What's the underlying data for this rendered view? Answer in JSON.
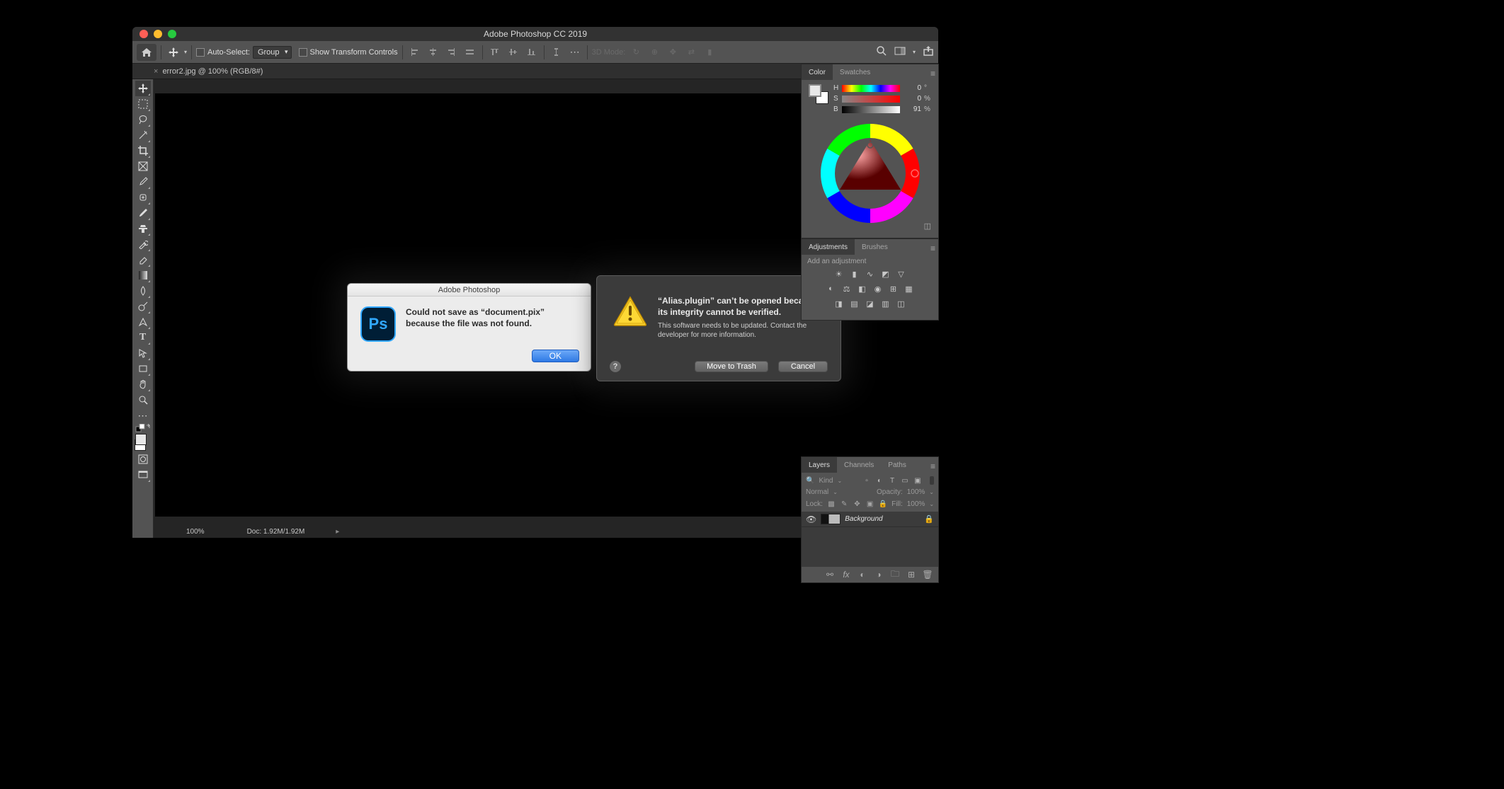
{
  "app": {
    "title": "Adobe Photoshop CC 2019"
  },
  "options_bar": {
    "auto_select_label": "Auto-Select:",
    "auto_select_value": "Group",
    "show_transform_label": "Show Transform Controls",
    "mode_3d_label": "3D Mode:"
  },
  "document_tab": {
    "label": "error2.jpg @ 100% (RGB/8#)"
  },
  "status_bar": {
    "zoom": "100%",
    "doc_size": "Doc: 1.92M/1.92M"
  },
  "color_panel": {
    "tab_color": "Color",
    "tab_swatches": "Swatches",
    "h": {
      "label": "H",
      "value": "0",
      "unit": "°"
    },
    "s": {
      "label": "S",
      "value": "0",
      "unit": "%"
    },
    "b": {
      "label": "B",
      "value": "91",
      "unit": "%"
    }
  },
  "adjustments_panel": {
    "tab_adjustments": "Adjustments",
    "tab_brushes": "Brushes",
    "hint": "Add an adjustment"
  },
  "layers_panel": {
    "tab_layers": "Layers",
    "tab_channels": "Channels",
    "tab_paths": "Paths",
    "kind_label": "Kind",
    "blend_mode": "Normal",
    "opacity_label": "Opacity:",
    "opacity_value": "100%",
    "lock_label": "Lock:",
    "fill_label": "Fill:",
    "fill_value": "100%",
    "layer_name": "Background"
  },
  "dialog_light": {
    "title": "Adobe Photoshop",
    "message": "Could not save as “document.pix” because the file was not found.",
    "ok_label": "OK"
  },
  "dialog_dark": {
    "message_bold": "“Alias.plugin” can’t be opened because its integrity cannot be verified.",
    "message_sub": "This software needs to be updated. Contact the developer for more information.",
    "trash_label": "Move to Trash",
    "cancel_label": "Cancel"
  }
}
